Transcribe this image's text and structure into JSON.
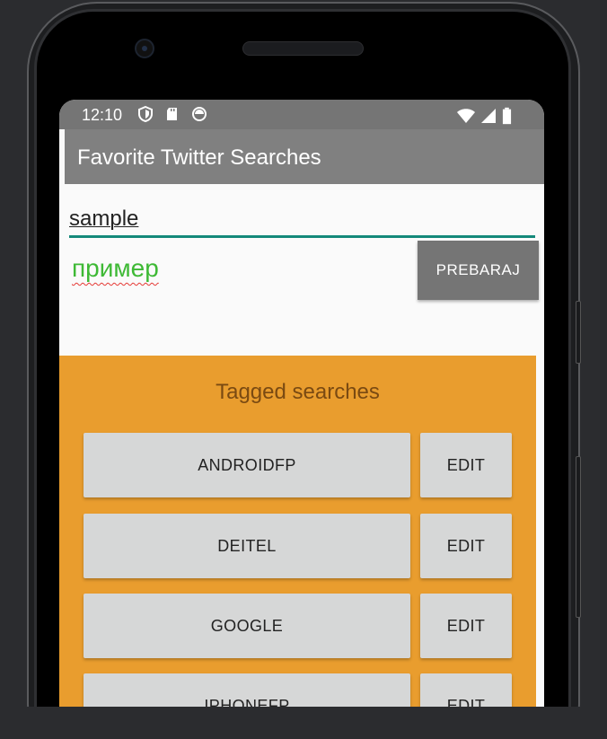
{
  "status_bar": {
    "time": "12:10",
    "left_icons": [
      "shield-icon",
      "sd-card-icon",
      "sync-icon"
    ],
    "right_icons": [
      "wifi-icon",
      "signal-icon",
      "battery-icon"
    ]
  },
  "app_bar": {
    "title": "Favorite Twitter Searches"
  },
  "form": {
    "query_value": "sample",
    "tag_value": "пример",
    "search_button_label": "PREBARAJ"
  },
  "tagged": {
    "title": "Tagged searches",
    "items": [
      {
        "tag": "ANDROIDFP",
        "edit_label": "EDIT"
      },
      {
        "tag": "DEITEL",
        "edit_label": "EDIT"
      },
      {
        "tag": "GOOGLE",
        "edit_label": "EDIT"
      },
      {
        "tag": "IPHONEFP",
        "edit_label": "EDIT"
      }
    ]
  },
  "colors": {
    "status_bar": "#757575",
    "app_bar": "#808080",
    "accent_underline": "#14897a",
    "tag_text": "#3eb935",
    "tagged_panel": "#e99d2e",
    "button_bg": "#d6d7d7"
  }
}
